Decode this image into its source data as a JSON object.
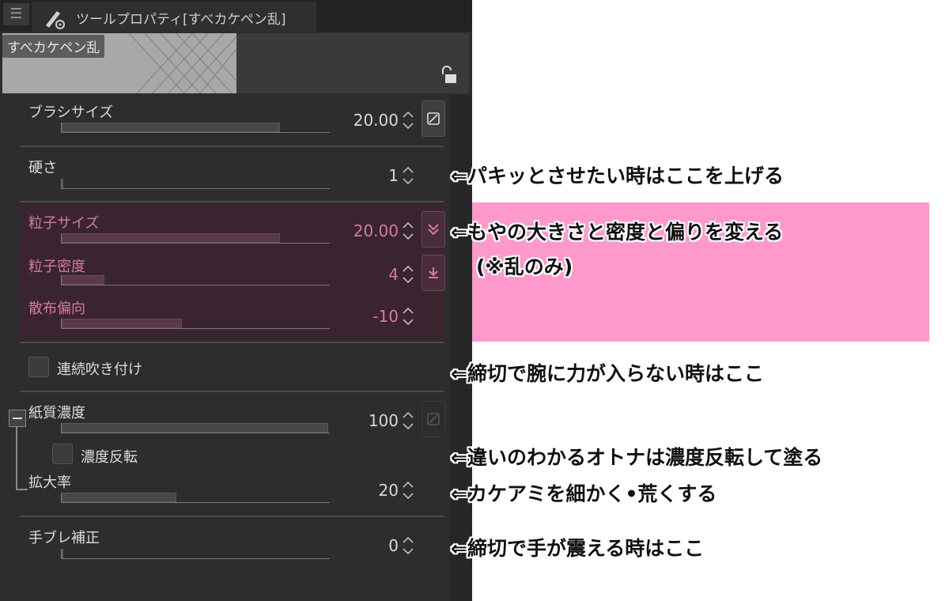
{
  "panel": {
    "title": "ツールプロパティ[すべカケペン乱]",
    "preview_label": "すべカケペン乱"
  },
  "properties": {
    "brush_size": {
      "label": "ブラシサイズ",
      "value": "20.00",
      "fill": 0.82
    },
    "hardness": {
      "label": "硬さ",
      "value": "1",
      "fill": 0.0
    },
    "particle_size": {
      "label": "粒子サイズ",
      "value": "20.00",
      "fill": 0.82
    },
    "particle_density": {
      "label": "粒子密度",
      "value": "4",
      "fill": 0.16
    },
    "spray_deviation": {
      "label": "散布偏向",
      "value": "-10",
      "fill": 0.45
    },
    "continuous_spray": {
      "label": "連続吹き付け"
    },
    "paper_density": {
      "label": "紙質濃度",
      "value": "100",
      "fill": 1.0
    },
    "invert_density": {
      "label": "濃度反転"
    },
    "magnification": {
      "label": "拡大率",
      "value": "20",
      "fill": 0.43
    },
    "stabilization": {
      "label": "手ブレ補正",
      "value": "0",
      "fill": 0.0
    }
  },
  "annotations": {
    "a1": "⇐パキッとさせたい時はここを上げる",
    "a2": "⇐もやの大きさと密度と偏りを変える",
    "a2b": "(※乱のみ)",
    "a3": "⇐締切で腕に力が入らない時はここ",
    "a4": "⇐違いのわかるオトナは濃度反転して塗る",
    "a5": "⇐カケアミを細かく•荒くする",
    "a6": "⇐締切で手が震える時はここ"
  },
  "colors": {
    "highlight": "#ff99cc",
    "pink_text": "#d47ba1",
    "panel_bg": "#2d2d2d"
  },
  "icons": [
    "menu-icon",
    "brush-gear-icon",
    "lock-icon",
    "spinner-icon",
    "pressure-icon",
    "chevron-double-down-icon",
    "download-icon"
  ]
}
